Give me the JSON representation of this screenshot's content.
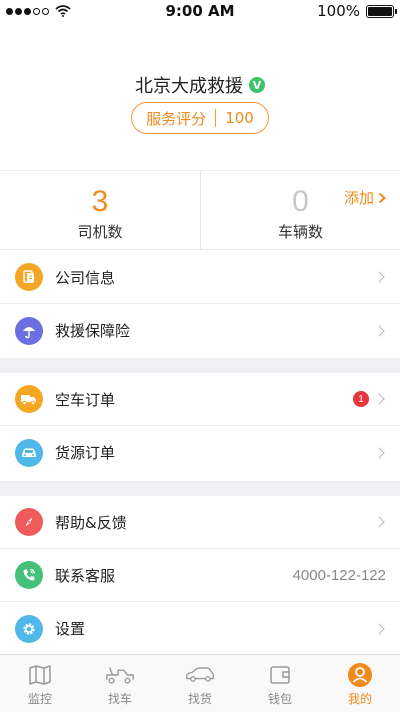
{
  "status_bar": {
    "time": "9:00 AM",
    "battery": "100%",
    "signal_bars": 3,
    "signal_total": 5,
    "battery_level": 1.0
  },
  "profile": {
    "company_name": "北京大成救援",
    "verified_mark": "V",
    "score_label": "服务评分",
    "score_value": "100"
  },
  "stats": {
    "drivers": {
      "value": "3",
      "label": "司机数"
    },
    "vehicles": {
      "value": "0",
      "label": "车辆数",
      "add_label": "添加"
    }
  },
  "menu": {
    "company_info": "公司信息",
    "insurance": "救援保障险",
    "empty_orders": "空车订单",
    "empty_orders_badge": "1",
    "cargo_orders": "货源订单",
    "help": "帮助&反馈",
    "contact": "联系客服",
    "contact_phone": "4000-122-122",
    "settings": "设置"
  },
  "tabs": [
    {
      "label": "监控",
      "icon": "map-icon"
    },
    {
      "label": "找车",
      "icon": "truck-icon"
    },
    {
      "label": "找货",
      "icon": "car-icon"
    },
    {
      "label": "钱包",
      "icon": "wallet-icon"
    },
    {
      "label": "我的",
      "icon": "user-icon"
    }
  ],
  "active_tab": "我的",
  "colors": {
    "accent": "#f08a1c",
    "verified": "#3cc36b",
    "badge": "#e8353b",
    "divider_bg": "#efeff4"
  }
}
